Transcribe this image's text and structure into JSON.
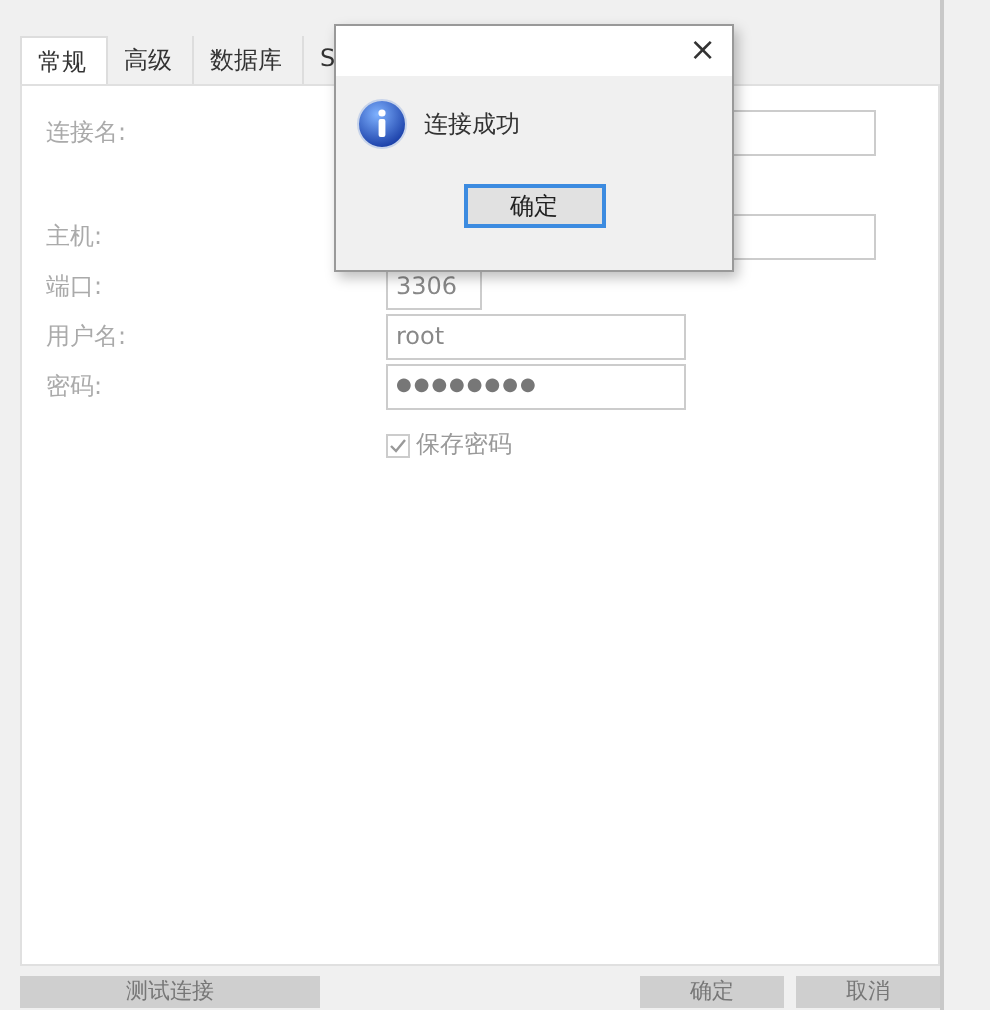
{
  "tabs": [
    {
      "label": "常规",
      "selected": true
    },
    {
      "label": "高级",
      "selected": false
    },
    {
      "label": "数据库",
      "selected": false
    },
    {
      "label": "S",
      "selected": false
    }
  ],
  "form": {
    "rows": [
      {
        "label": "连接名:",
        "kind": "text"
      },
      {
        "label": "主机:",
        "kind": "text"
      },
      {
        "label": "端口:",
        "kind": "short",
        "value": "3306"
      },
      {
        "label": "用户名:",
        "kind": "text",
        "value": "root"
      },
      {
        "label": "密码:",
        "kind": "password",
        "value": "●●●●●●●●"
      }
    ],
    "save_password": {
      "label": "保存密码",
      "checked": true,
      "disabled": true
    }
  },
  "buttons": [
    {
      "label": "测试连接",
      "kind": "left"
    },
    {
      "label": "确定",
      "kind": "right"
    },
    {
      "label": "取消",
      "kind": "right"
    }
  ],
  "dialog": {
    "close": "×",
    "message": "连接成功",
    "button": "确定"
  }
}
